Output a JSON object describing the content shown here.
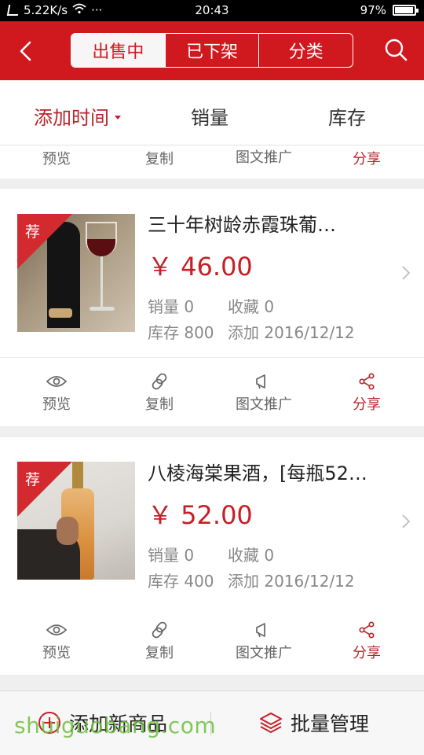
{
  "status_bar": {
    "speed": "5.22K/s",
    "more": "···",
    "time": "20:43",
    "battery": "97%"
  },
  "header": {
    "tabs": [
      "出售中",
      "已下架",
      "分类"
    ],
    "active_tab": "出售中"
  },
  "sort": {
    "items": [
      "添加时间",
      "销量",
      "库存"
    ]
  },
  "actions": {
    "preview": "预览",
    "copy": "复制",
    "promote": "图文推广",
    "share": "分享"
  },
  "products": [
    {
      "badge": "荐",
      "title": "三十年树龄赤霞珠葡…",
      "price": "￥ 46.00",
      "sales": "销量 0",
      "favorites": "收藏 0",
      "stock": "库存 800",
      "added": "添加 2016/12/12"
    },
    {
      "badge": "荐",
      "title": "八棱海棠果酒，[每瓶52…",
      "price": "￥ 52.00",
      "sales": "销量 0",
      "favorites": "收藏 0",
      "stock": "库存 400",
      "added": "添加 2016/12/12"
    }
  ],
  "bottom_bar": {
    "add_label": "添加新商品",
    "batch_label": "批量管理"
  },
  "watermark": "shuiguobang.com",
  "colors": {
    "brand_red": "#d0191f",
    "price_red": "#c81e26"
  }
}
